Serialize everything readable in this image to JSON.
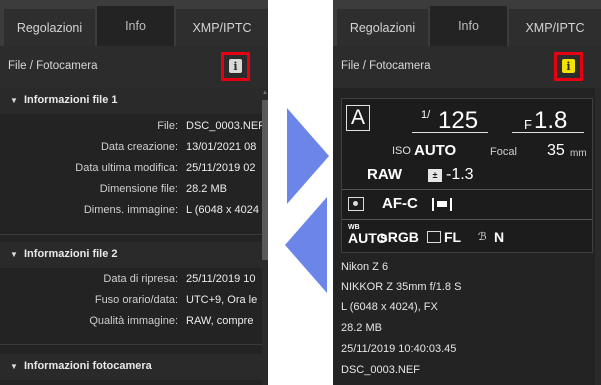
{
  "tabs": [
    "Regolazioni",
    "Info",
    "XMP/IPTC"
  ],
  "subheader": {
    "label": "File / Fotocamera",
    "info_glyph": "i"
  },
  "colors": {
    "highlight": "#e60012",
    "info_active": "#f4e300",
    "nav_arrow": "#6b86e8"
  },
  "left": {
    "sections": [
      {
        "title": "Informazioni file 1",
        "rows": [
          {
            "label": "File:",
            "value": "DSC_0003.NEF"
          },
          {
            "label": "Data creazione:",
            "value": "13/01/2021 08"
          },
          {
            "label": "Data ultima modifica:",
            "value": "25/11/2019 02"
          },
          {
            "label": "Dimensione file:",
            "value": "28.2 MB"
          },
          {
            "label": "Dimens. immagine:",
            "value": "L (6048 x 4024"
          }
        ]
      },
      {
        "title": "Informazioni file 2",
        "rows": [
          {
            "label": "Data di ripresa:",
            "value": "25/11/2019 10"
          },
          {
            "label": "Fuso orario/data:",
            "value": "UTC+9, Ora le"
          },
          {
            "label": "Qualità immagine:",
            "value": "RAW, compre"
          }
        ]
      },
      {
        "title": "Informazioni fotocamera",
        "rows": []
      }
    ]
  },
  "right": {
    "shooting": {
      "mode": "A",
      "shutter_sup": "1/",
      "shutter": "125",
      "aperture_prefix": "F",
      "aperture": "1.8",
      "iso_label": "ISO",
      "iso_value": "AUTO",
      "focal_label": "Focal",
      "focal_value": "35",
      "focal_unit": "mm",
      "quality": "RAW",
      "ev_icon": "±",
      "ev_value": "-1.3",
      "af_mode": "AF-C",
      "wb_small": "WB",
      "wb_value": "AUTO",
      "color_space": "sRGB",
      "picture_control": "FL",
      "adl_icon": "ℬ",
      "adl_value": "N"
    },
    "summary": [
      "Nikon Z 6",
      "NIKKOR Z 35mm f/1.8 S",
      "L (6048 x 4024), FX",
      "28.2 MB",
      "25/11/2019 10:40:03.45",
      "DSC_0003.NEF"
    ]
  }
}
